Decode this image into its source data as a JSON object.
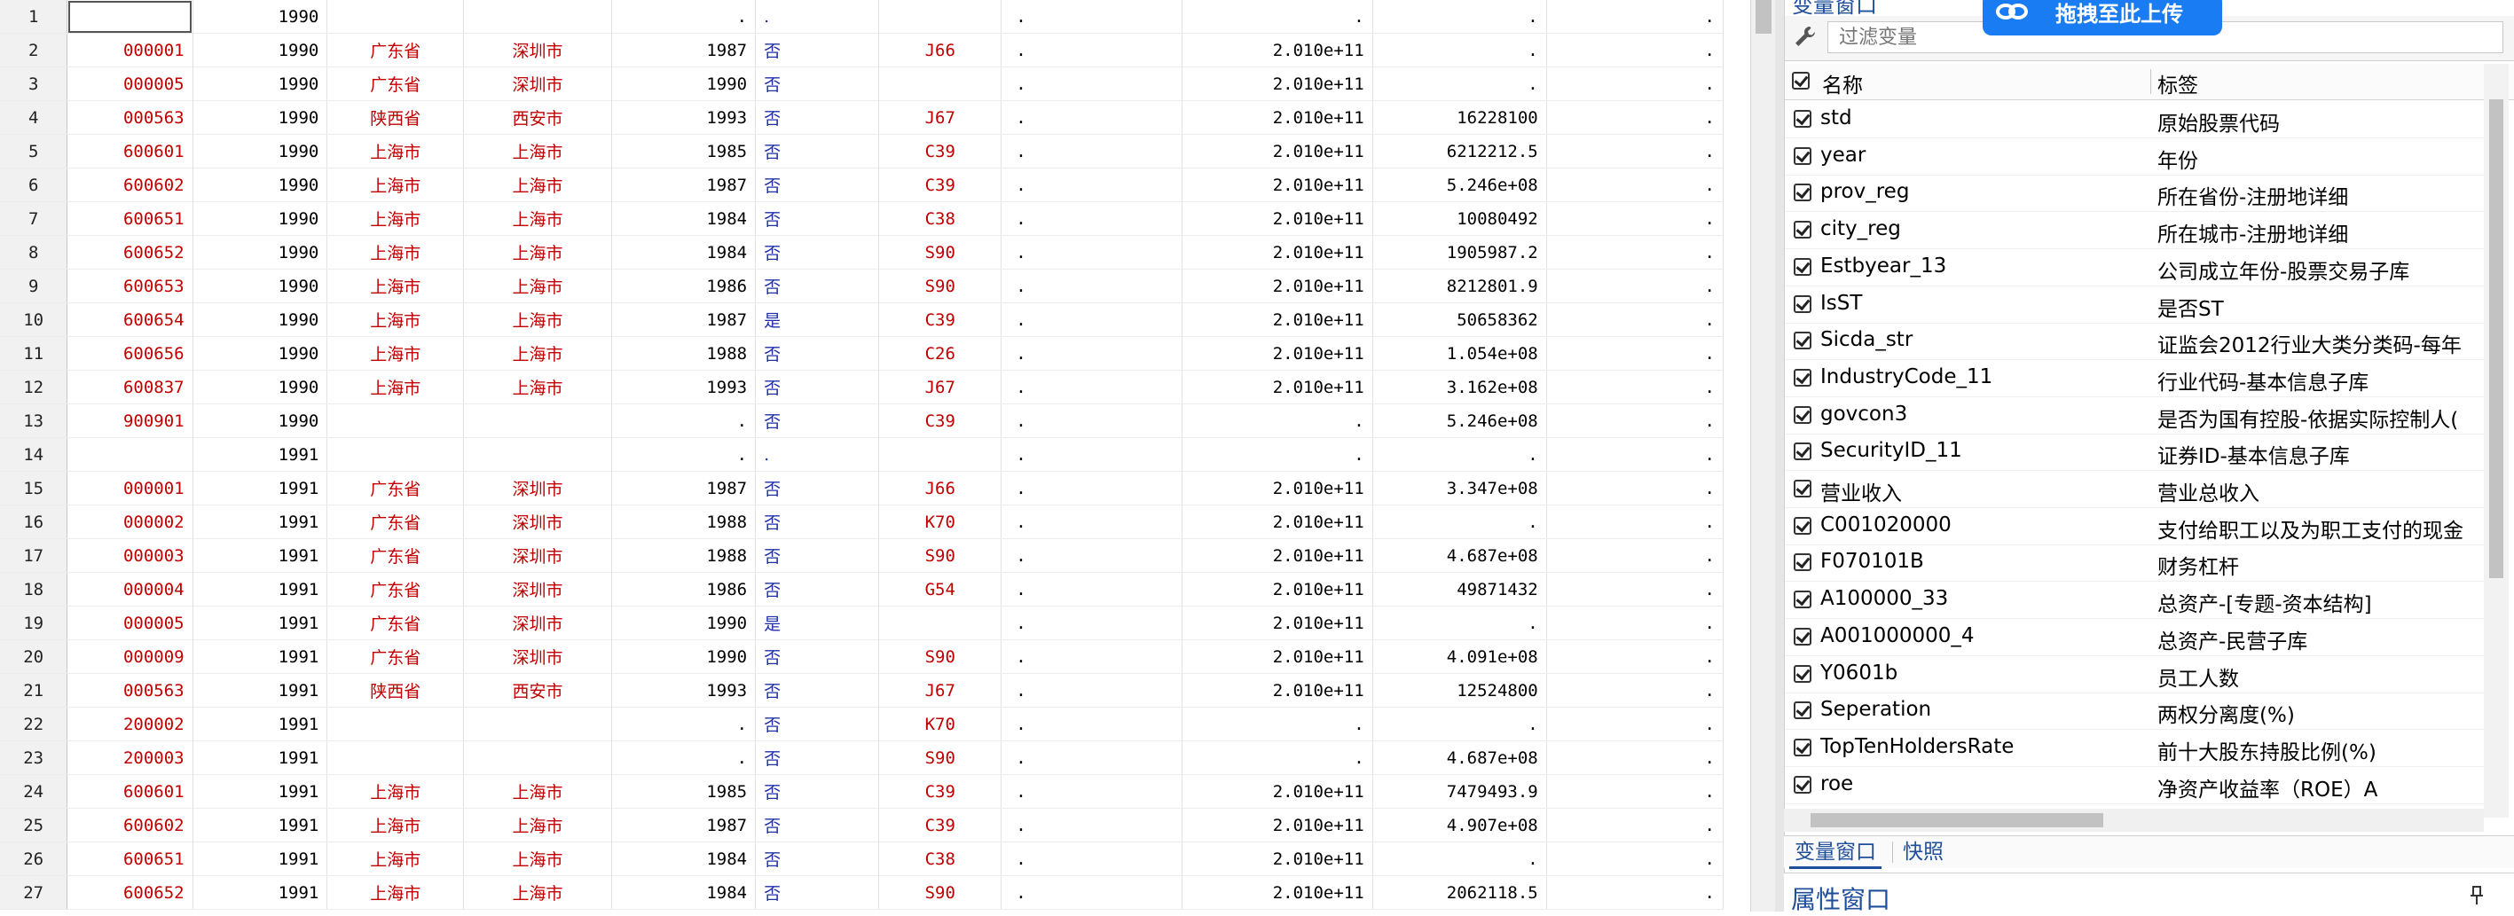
{
  "grid": {
    "rows": [
      [
        "1",
        "",
        "1990",
        "",
        "",
        ".",
        ".",
        "",
        ".",
        ".",
        ".",
        "."
      ],
      [
        "2",
        "000001",
        "1990",
        "广东省",
        "深圳市",
        "1987",
        "否",
        "J66",
        ".",
        "2.010e+11",
        ".",
        "."
      ],
      [
        "3",
        "000005",
        "1990",
        "广东省",
        "深圳市",
        "1990",
        "否",
        "",
        ".",
        "2.010e+11",
        ".",
        "."
      ],
      [
        "4",
        "000563",
        "1990",
        "陕西省",
        "西安市",
        "1993",
        "否",
        "J67",
        ".",
        "2.010e+11",
        "16228100",
        "."
      ],
      [
        "5",
        "600601",
        "1990",
        "上海市",
        "上海市",
        "1985",
        "否",
        "C39",
        ".",
        "2.010e+11",
        "6212212.5",
        "."
      ],
      [
        "6",
        "600602",
        "1990",
        "上海市",
        "上海市",
        "1987",
        "否",
        "C39",
        ".",
        "2.010e+11",
        "5.246e+08",
        "."
      ],
      [
        "7",
        "600651",
        "1990",
        "上海市",
        "上海市",
        "1984",
        "否",
        "C38",
        ".",
        "2.010e+11",
        "10080492",
        "."
      ],
      [
        "8",
        "600652",
        "1990",
        "上海市",
        "上海市",
        "1984",
        "否",
        "S90",
        ".",
        "2.010e+11",
        "1905987.2",
        "."
      ],
      [
        "9",
        "600653",
        "1990",
        "上海市",
        "上海市",
        "1986",
        "否",
        "S90",
        ".",
        "2.010e+11",
        "8212801.9",
        "."
      ],
      [
        "10",
        "600654",
        "1990",
        "上海市",
        "上海市",
        "1987",
        "是",
        "C39",
        ".",
        "2.010e+11",
        "50658362",
        "."
      ],
      [
        "11",
        "600656",
        "1990",
        "上海市",
        "上海市",
        "1988",
        "否",
        "C26",
        ".",
        "2.010e+11",
        "1.054e+08",
        "."
      ],
      [
        "12",
        "600837",
        "1990",
        "上海市",
        "上海市",
        "1993",
        "否",
        "J67",
        ".",
        "2.010e+11",
        "3.162e+08",
        "."
      ],
      [
        "13",
        "900901",
        "1990",
        "",
        "",
        ".",
        "否",
        "C39",
        ".",
        ".",
        "5.246e+08",
        "."
      ],
      [
        "14",
        "",
        "1991",
        "",
        "",
        ".",
        ".",
        "",
        ".",
        ".",
        ".",
        "."
      ],
      [
        "15",
        "000001",
        "1991",
        "广东省",
        "深圳市",
        "1987",
        "否",
        "J66",
        ".",
        "2.010e+11",
        "3.347e+08",
        "."
      ],
      [
        "16",
        "000002",
        "1991",
        "广东省",
        "深圳市",
        "1988",
        "否",
        "K70",
        ".",
        "2.010e+11",
        ".",
        "."
      ],
      [
        "17",
        "000003",
        "1991",
        "广东省",
        "深圳市",
        "1988",
        "否",
        "S90",
        ".",
        "2.010e+11",
        "4.687e+08",
        "."
      ],
      [
        "18",
        "000004",
        "1991",
        "广东省",
        "深圳市",
        "1986",
        "否",
        "G54",
        ".",
        "2.010e+11",
        "49871432",
        "."
      ],
      [
        "19",
        "000005",
        "1991",
        "广东省",
        "深圳市",
        "1990",
        "是",
        "",
        ".",
        "2.010e+11",
        ".",
        "."
      ],
      [
        "20",
        "000009",
        "1991",
        "广东省",
        "深圳市",
        "1990",
        "否",
        "S90",
        ".",
        "2.010e+11",
        "4.091e+08",
        "."
      ],
      [
        "21",
        "000563",
        "1991",
        "陕西省",
        "西安市",
        "1993",
        "否",
        "J67",
        ".",
        "2.010e+11",
        "12524800",
        "."
      ],
      [
        "22",
        "200002",
        "1991",
        "",
        "",
        ".",
        "否",
        "K70",
        ".",
        ".",
        ".",
        "."
      ],
      [
        "23",
        "200003",
        "1991",
        "",
        "",
        ".",
        "否",
        "S90",
        ".",
        ".",
        "4.687e+08",
        "."
      ],
      [
        "24",
        "600601",
        "1991",
        "上海市",
        "上海市",
        "1985",
        "否",
        "C39",
        ".",
        "2.010e+11",
        "7479493.9",
        "."
      ],
      [
        "25",
        "600602",
        "1991",
        "上海市",
        "上海市",
        "1987",
        "否",
        "C39",
        ".",
        "2.010e+11",
        "4.907e+08",
        "."
      ],
      [
        "26",
        "600651",
        "1991",
        "上海市",
        "上海市",
        "1984",
        "否",
        "C38",
        ".",
        "2.010e+11",
        ".",
        "."
      ],
      [
        "27",
        "600652",
        "1991",
        "上海市",
        "上海市",
        "1984",
        "否",
        "S90",
        ".",
        "2.010e+11",
        "2062118.5",
        "."
      ]
    ]
  },
  "varpanel": {
    "title": "变量窗口",
    "filter_placeholder": "过滤变量",
    "upload_badge": "拖拽至此上传",
    "header": {
      "name": "名称",
      "label": "标签"
    },
    "variables": [
      {
        "name": "std",
        "label": "原始股票代码"
      },
      {
        "name": "year",
        "label": "年份"
      },
      {
        "name": "prov_reg",
        "label": "所在省份-注册地详细"
      },
      {
        "name": "city_reg",
        "label": "所在城市-注册地详细"
      },
      {
        "name": "Estbyear_13",
        "label": "公司成立年份-股票交易子库"
      },
      {
        "name": "IsST",
        "label": "是否ST"
      },
      {
        "name": "Sicda_str",
        "label": "证监会2012行业大类分类码-每年"
      },
      {
        "name": "IndustryCode_11",
        "label": "行业代码-基本信息子库"
      },
      {
        "name": "govcon3",
        "label": "是否为国有控股-依据实际控制人("
      },
      {
        "name": "SecurityID_11",
        "label": "证券ID-基本信息子库"
      },
      {
        "name": "营业收入",
        "label": "营业总收入"
      },
      {
        "name": "C001020000",
        "label": "支付给职工以及为职工支付的现金"
      },
      {
        "name": "F070101B",
        "label": "财务杠杆"
      },
      {
        "name": "A100000_33",
        "label": "总资产-[专题-资本结构]"
      },
      {
        "name": "A001000000_4",
        "label": "总资产-民营子库"
      },
      {
        "name": "Y0601b",
        "label": "员工人数"
      },
      {
        "name": "Seperation",
        "label": "两权分离度(%)"
      },
      {
        "name": "TopTenHoldersRate",
        "label": "前十大股东持股比例(%)"
      },
      {
        "name": "roe",
        "label": "净资产收益率（ROE）A"
      }
    ],
    "tabs": {
      "variables": "变量窗口",
      "snapshots": "快照"
    },
    "properties_title": "属性窗口"
  }
}
